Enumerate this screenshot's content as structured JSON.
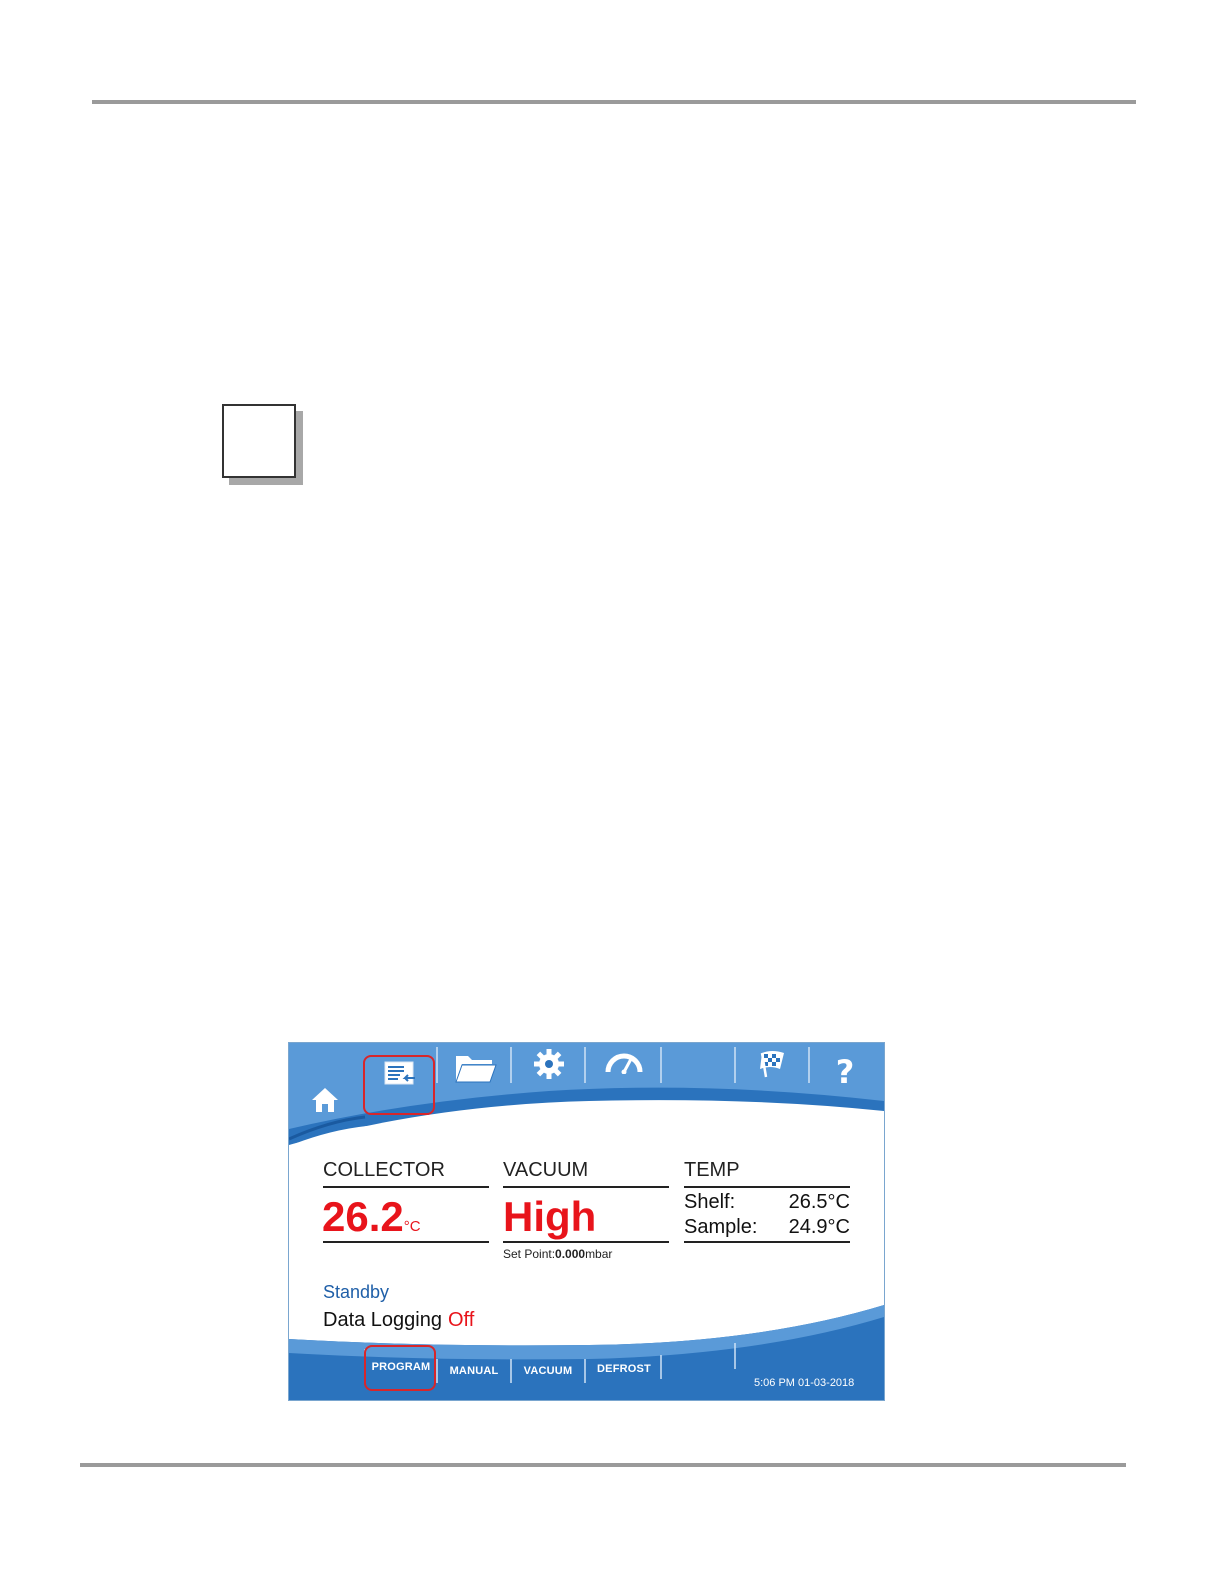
{
  "screen": {
    "colors": {
      "header_blue": "#2b73bd",
      "light_blue": "#5a9ad8",
      "value_red": "#e8141b",
      "status_blue": "#1f5fa8",
      "highlight_red": "#d7262b"
    },
    "top_icons": [
      "home-icon",
      "program-list-icon",
      "folder-icon",
      "gear-icon",
      "gauge-icon",
      "checkered-flag-icon",
      "help-icon"
    ],
    "help_label": "?",
    "collector": {
      "label": "COLLECTOR",
      "value": "26.2",
      "unit": "°C"
    },
    "vacuum": {
      "label": "VACUUM",
      "value": "High",
      "setpoint_label": "Set Point:",
      "setpoint_value": "0.000",
      "setpoint_unit": "mbar"
    },
    "temp": {
      "label": "TEMP",
      "shelf_label": "Shelf:",
      "shelf_value": "26.5°C",
      "sample_label": "Sample:",
      "sample_value": "24.9°C"
    },
    "status": "Standby",
    "data_logging": {
      "label": "Data Logging",
      "value": "Off"
    },
    "bottom_tabs": [
      "PROGRAM",
      "MANUAL",
      "VACUUM",
      "DEFROST"
    ],
    "datetime": "5:06 PM 01-03-2018"
  }
}
